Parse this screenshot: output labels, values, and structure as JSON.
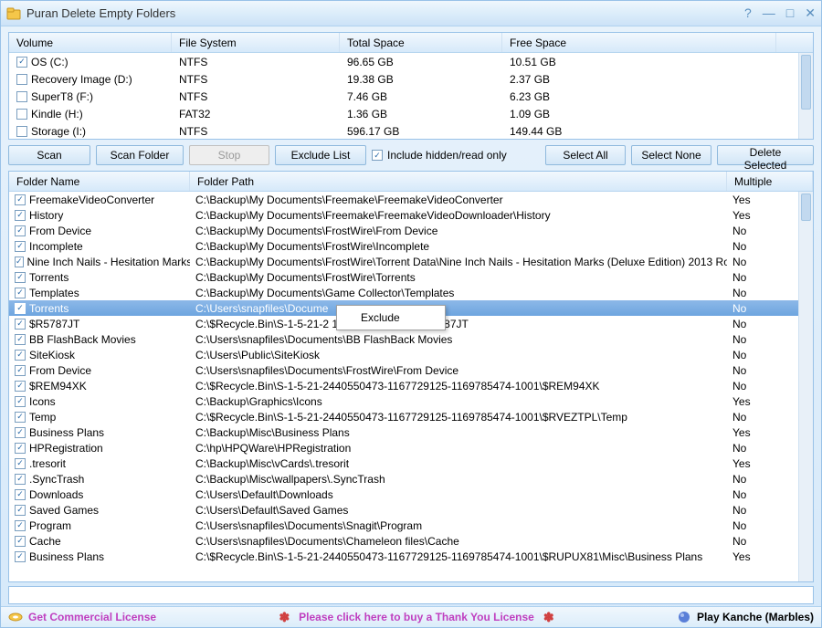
{
  "title": "Puran Delete Empty Folders",
  "volumesHeader": {
    "c1": "Volume",
    "c2": "File System",
    "c3": "Total Space",
    "c4": "Free Space"
  },
  "volumes": [
    {
      "checked": true,
      "name": "OS (C:)",
      "fs": "NTFS",
      "total": "96.65 GB",
      "free": "10.51 GB"
    },
    {
      "checked": false,
      "name": "Recovery Image (D:)",
      "fs": "NTFS",
      "total": "19.38 GB",
      "free": "2.37 GB"
    },
    {
      "checked": false,
      "name": "SuperT8 (F:)",
      "fs": "NTFS",
      "total": "7.46 GB",
      "free": "6.23 GB"
    },
    {
      "checked": false,
      "name": "Kindle (H:)",
      "fs": "FAT32",
      "total": "1.36 GB",
      "free": "1.09 GB"
    },
    {
      "checked": false,
      "name": "Storage (I:)",
      "fs": "NTFS",
      "total": "596.17 GB",
      "free": "149.44 GB"
    }
  ],
  "toolbar": {
    "scan": "Scan",
    "scanFolder": "Scan Folder",
    "stop": "Stop",
    "excludeList": "Exclude List",
    "includeHidden": "Include hidden/read only",
    "selectAll": "Select All",
    "selectNone": "Select None",
    "deleteSelected": "Delete Selected"
  },
  "foldersHeader": {
    "c1": "Folder Name",
    "c2": "Folder Path",
    "c3": "Multiple"
  },
  "folders": [
    {
      "n": "FreemakeVideoConverter",
      "p": "C:\\Backup\\My Documents\\Freemake\\FreemakeVideoConverter",
      "m": "Yes"
    },
    {
      "n": "History",
      "p": "C:\\Backup\\My Documents\\Freemake\\FreemakeVideoDownloader\\History",
      "m": "Yes"
    },
    {
      "n": "From Device",
      "p": "C:\\Backup\\My Documents\\FrostWire\\From Device",
      "m": "No"
    },
    {
      "n": "Incomplete",
      "p": "C:\\Backup\\My Documents\\FrostWire\\Incomplete",
      "m": "No"
    },
    {
      "n": "Nine Inch Nails - Hesitation Marks...",
      "p": "C:\\Backup\\My Documents\\FrostWire\\Torrent Data\\Nine Inch Nails - Hesitation Marks (Deluxe Edition) 2013 Ro...",
      "m": "No"
    },
    {
      "n": "Torrents",
      "p": "C:\\Backup\\My Documents\\FrostWire\\Torrents",
      "m": "No"
    },
    {
      "n": "Templates",
      "p": "C:\\Backup\\My Documents\\Game Collector\\Templates",
      "m": "No"
    },
    {
      "n": "Torrents",
      "p": "C:\\Users\\snapfiles\\Docume",
      "m": "No",
      "sel": true
    },
    {
      "n": "$R5787JT",
      "p": "C:\\$Recycle.Bin\\S-1-5-21-2                                169785474-1001\\$R5787JT",
      "m": "No"
    },
    {
      "n": "BB FlashBack Movies",
      "p": "C:\\Users\\snapfiles\\Documents\\BB FlashBack Movies",
      "m": "No"
    },
    {
      "n": "SiteKiosk",
      "p": "C:\\Users\\Public\\SiteKiosk",
      "m": "No"
    },
    {
      "n": "From Device",
      "p": "C:\\Users\\snapfiles\\Documents\\FrostWire\\From Device",
      "m": "No"
    },
    {
      "n": "$REM94XK",
      "p": "C:\\$Recycle.Bin\\S-1-5-21-2440550473-1167729125-1169785474-1001\\$REM94XK",
      "m": "No"
    },
    {
      "n": "Icons",
      "p": "C:\\Backup\\Graphics\\Icons",
      "m": "Yes"
    },
    {
      "n": "Temp",
      "p": "C:\\$Recycle.Bin\\S-1-5-21-2440550473-1167729125-1169785474-1001\\$RVEZTPL\\Temp",
      "m": "No"
    },
    {
      "n": "Business Plans",
      "p": "C:\\Backup\\Misc\\Business Plans",
      "m": "Yes"
    },
    {
      "n": "HPRegistration",
      "p": "C:\\hp\\HPQWare\\HPRegistration",
      "m": "No"
    },
    {
      "n": ".tresorit",
      "p": "C:\\Backup\\Misc\\vCards\\.tresorit",
      "m": "Yes"
    },
    {
      "n": ".SyncTrash",
      "p": "C:\\Backup\\Misc\\wallpapers\\.SyncTrash",
      "m": "No"
    },
    {
      "n": "Downloads",
      "p": "C:\\Users\\Default\\Downloads",
      "m": "No"
    },
    {
      "n": "Saved Games",
      "p": "C:\\Users\\Default\\Saved Games",
      "m": "No"
    },
    {
      "n": "Program",
      "p": "C:\\Users\\snapfiles\\Documents\\Snagit\\Program",
      "m": "No"
    },
    {
      "n": "Cache",
      "p": "C:\\Users\\snapfiles\\Documents\\Chameleon files\\Cache",
      "m": "No"
    },
    {
      "n": "Business Plans",
      "p": "C:\\$Recycle.Bin\\S-1-5-21-2440550473-1167729125-1169785474-1001\\$RUPUX81\\Misc\\Business Plans",
      "m": "Yes"
    }
  ],
  "contextMenu": {
    "exclude": "Exclude"
  },
  "status": {
    "license": "Get Commercial License",
    "thankyou": "Please click here to buy a Thank You License",
    "play": "Play Kanche (Marbles)"
  }
}
